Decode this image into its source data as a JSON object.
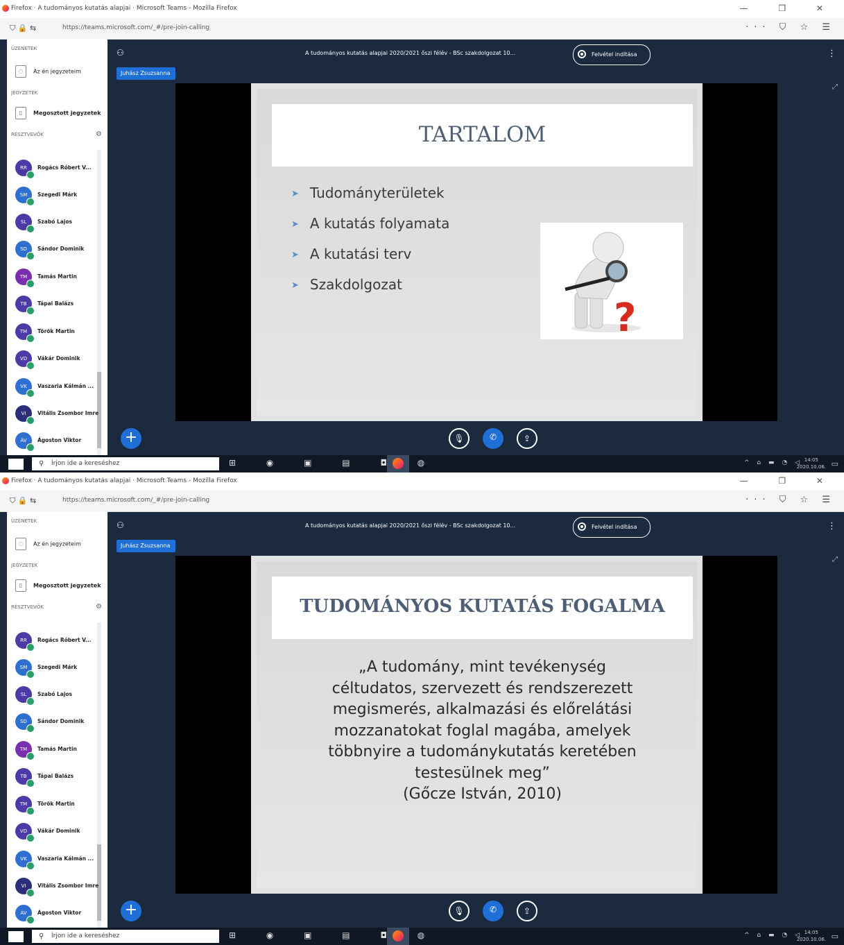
{
  "browser": {
    "window_title": "Firefox · A tudományos kutatás alapjai · Microsoft Teams - Mozilla Firefox",
    "url": "https://teams.microsoft.com/_#/pre-join-calling",
    "window_controls": "— ❐ ✕",
    "nav_icons": "⛉ 🔒 ⇆",
    "toolbar_icons": "··· ⛉ ☆ ☰"
  },
  "sidebar": {
    "section_meetings": "ÜZENETEK",
    "my_notes": "Az én jegyzeteim",
    "section_files": "JEGYZETEK",
    "shared_notes": "Megosztott jegyzetek",
    "section_participants": "RÉSZTVEVŐK",
    "participants": [
      {
        "initials": "RR",
        "name": "Rogács Róbert V...",
        "color": "#4c3aa6"
      },
      {
        "initials": "SM",
        "name": "Szegedi Márk",
        "color": "#2f6fd0"
      },
      {
        "initials": "SL",
        "name": "Szabó Lajos",
        "color": "#4c3aa6"
      },
      {
        "initials": "SD",
        "name": "Sándor Dominik",
        "color": "#2f6fd0"
      },
      {
        "initials": "TM",
        "name": "Tamás Martin",
        "color": "#7a2fb0"
      },
      {
        "initials": "TB",
        "name": "Tápai Balázs",
        "color": "#4c3aa6"
      },
      {
        "initials": "TM",
        "name": "Török Martin",
        "color": "#4c3aa6"
      },
      {
        "initials": "VD",
        "name": "Vákár Dominik",
        "color": "#4c3aa6"
      },
      {
        "initials": "VK",
        "name": "Vaszaria Kálmán ...",
        "color": "#2f6fd0"
      },
      {
        "initials": "VI",
        "name": "Vitális Zsombor Imre",
        "color": "#2b2f7a"
      },
      {
        "initials": "ÁV",
        "name": "Ágoston Viktor",
        "color": "#2f6fd0"
      }
    ]
  },
  "meeting": {
    "title": "A tudományos kutatás alapjai 2020/2021 őszi félév - BSc szakdolgozat 10...",
    "record_label": "Felvétel indítása",
    "presenter": "Juhász Zsuzsanna"
  },
  "slides": [
    {
      "title": "TARTALOM",
      "bullets": [
        "Tudományterületek",
        "A kutatás folyamata",
        "A kutatási terv",
        "Szakdolgozat"
      ]
    },
    {
      "title": "TUDOMÁNYOS KUTATÁS FOGALMA",
      "quote_lines": [
        "„A tudomány, mint tevékenység",
        "céltudatos, szervezett és rendszerezett",
        "megismerés, alkalmazási és előrelátási",
        "mozzanatokat foglal magába, amelyek",
        "többnyire a tudománykutatás keretében",
        "testesülnek meg”",
        "(Gőcze István, 2010)"
      ]
    }
  ],
  "taskbar": {
    "search_placeholder": "Írjon ide a kereséshez",
    "time": "14:05",
    "date": "2020.10.06.",
    "tray": "^ ⌂ ▬ ◔ ◁"
  },
  "icons": {
    "add": "+",
    "mic_off": "🎙",
    "hangup": "✆",
    "share": "⇪",
    "more": "⋮",
    "expand": "⤢",
    "people": "⚇"
  }
}
